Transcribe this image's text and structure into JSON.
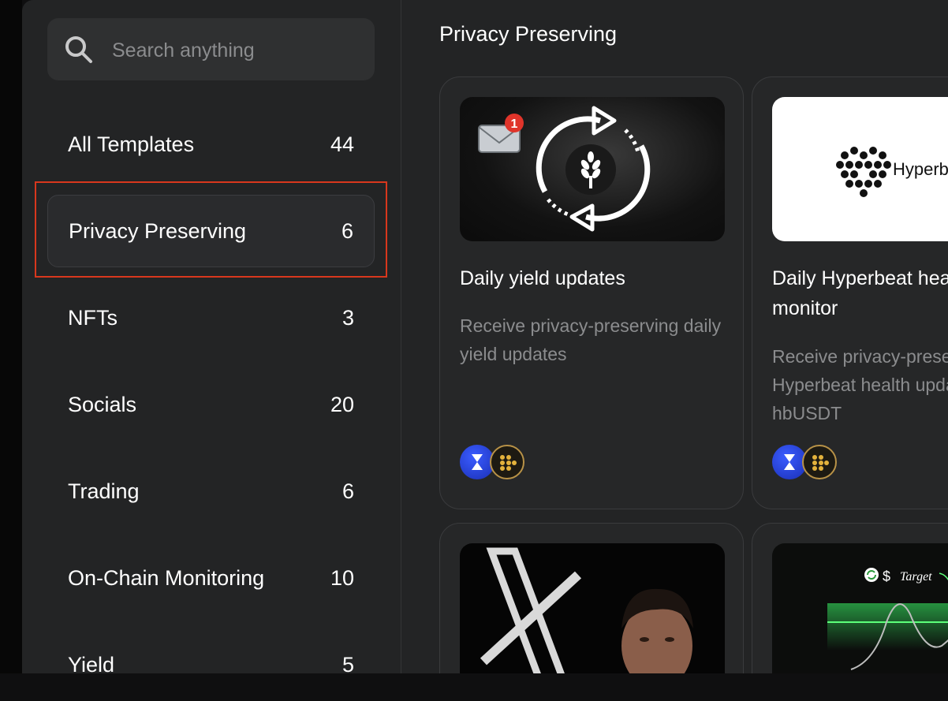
{
  "search": {
    "placeholder": "Search anything"
  },
  "categories": [
    {
      "label": "All Templates",
      "count": "44"
    },
    {
      "label": "Privacy Preserving",
      "count": "6"
    },
    {
      "label": "NFTs",
      "count": "3"
    },
    {
      "label": "Socials",
      "count": "20"
    },
    {
      "label": "Trading",
      "count": "6"
    },
    {
      "label": "On-Chain Monitoring",
      "count": "10"
    },
    {
      "label": "Yield",
      "count": "5"
    }
  ],
  "main": {
    "section_title": "Privacy Preserving",
    "cards": [
      {
        "title": "Daily yield updates",
        "description": "Receive privacy-preserving daily yield updates",
        "badge_count": "1"
      },
      {
        "title": "Daily Hyperbeat healthrate monitor",
        "description": "Receive privacy-preserving daily Hyperbeat health updates on hbUSDT",
        "logo_text": "Hyperbeat"
      }
    ],
    "card4_overlay": {
      "currency": "$",
      "label": "Target"
    }
  },
  "colors": {
    "highlight_border": "#d8371d",
    "sidebar_bg": "#232425",
    "muted_text": "#8b8c8e"
  }
}
